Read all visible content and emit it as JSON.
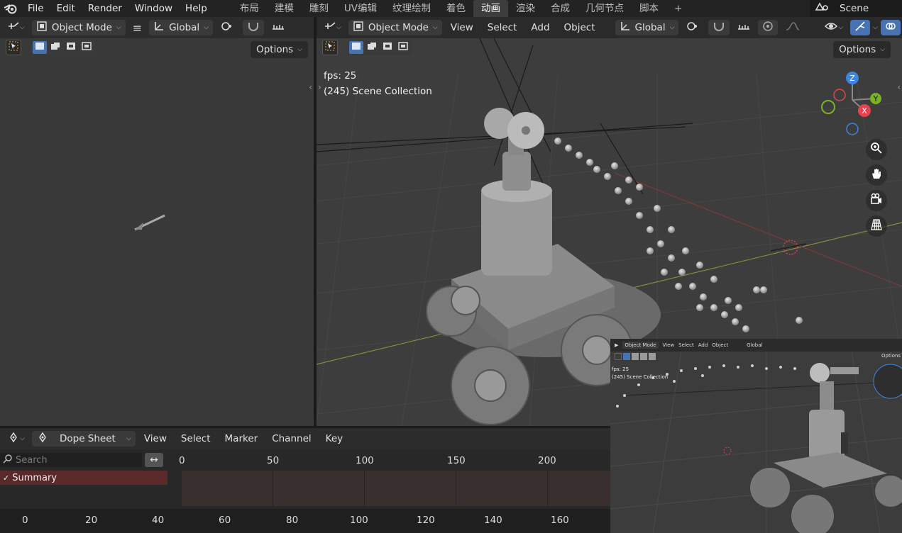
{
  "topbar": {
    "menus": [
      "File",
      "Edit",
      "Render",
      "Window",
      "Help"
    ],
    "workspaces": [
      "布局",
      "建模",
      "雕刻",
      "UV编辑",
      "纹理绘制",
      "着色",
      "动画",
      "渲染",
      "合成",
      "几何节点",
      "脚本"
    ],
    "active_workspace": "动画",
    "add_tab": "+",
    "scene_name": "Scene"
  },
  "left_viewport": {
    "mode": "Object Mode",
    "orientation": "Global",
    "options": "Options"
  },
  "main_viewport": {
    "mode": "Object Mode",
    "menus": [
      "View",
      "Select",
      "Add",
      "Object"
    ],
    "orientation": "Global",
    "options": "Options",
    "fps_text": "fps: 25",
    "collection_text": "(245) Scene Collection",
    "axes": {
      "z": "Z",
      "y": "Y",
      "x": "X"
    }
  },
  "dope_sheet": {
    "editor_name": "Dope Sheet",
    "menus": [
      "View",
      "Select",
      "Marker",
      "Channel",
      "Key"
    ],
    "search_placeholder": "Search",
    "summary_label": "Summary",
    "top_frames": [
      "0",
      "50",
      "100",
      "150",
      "200"
    ],
    "bottom_frames": [
      "0",
      "20",
      "40",
      "60",
      "80",
      "100",
      "120",
      "140",
      "160"
    ]
  },
  "pip": {
    "mode": "Object Mode",
    "menus": [
      "View",
      "Select",
      "Add",
      "Object"
    ],
    "orientation": "Global",
    "options": "Options",
    "fps_text": "fps: 25",
    "collection_text": "(245) Scene Collection"
  },
  "colors": {
    "accent": "#4772b3",
    "x_axis": "#e8414f",
    "y_axis": "#7ab321",
    "z_axis": "#3d86e0"
  }
}
